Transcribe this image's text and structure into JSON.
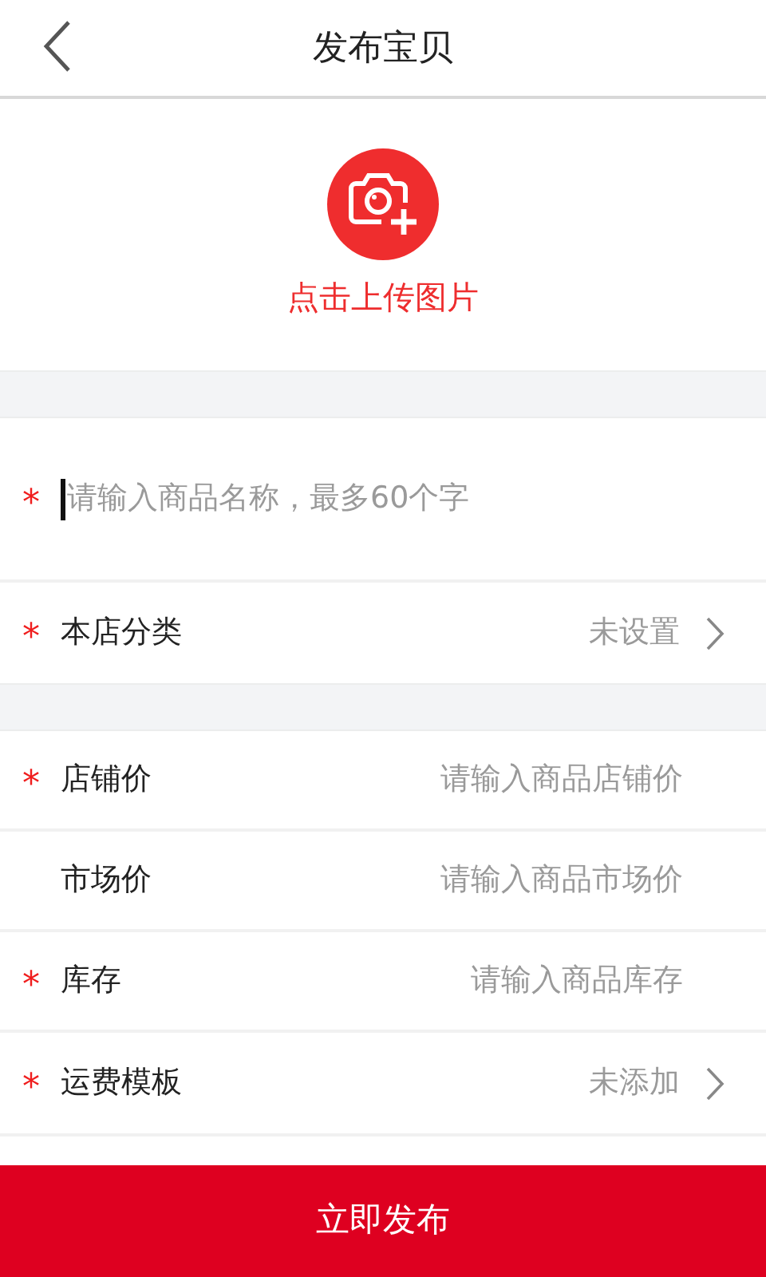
{
  "header": {
    "title": "发布宝贝"
  },
  "upload": {
    "label": "点击上传图片"
  },
  "sections": [
    [
      {
        "kind": "name",
        "required_mark": "*",
        "placeholder": "请输入商品名称，最多60个字",
        "focused": true
      },
      {
        "kind": "select",
        "required_mark": "*",
        "label": "本店分类",
        "value": "未设置"
      }
    ],
    [
      {
        "kind": "input",
        "required_mark": "*",
        "label": "店铺价",
        "placeholder": "请输入商品店铺价"
      },
      {
        "kind": "input",
        "label": "市场价",
        "placeholder": "请输入商品市场价"
      },
      {
        "kind": "input",
        "required_mark": "*",
        "label": "库存",
        "placeholder": "请输入商品库存"
      },
      {
        "kind": "select",
        "required_mark": "*",
        "label": "运费模板",
        "value": "未添加"
      }
    ]
  ],
  "submit": {
    "label": "立即发布"
  }
}
